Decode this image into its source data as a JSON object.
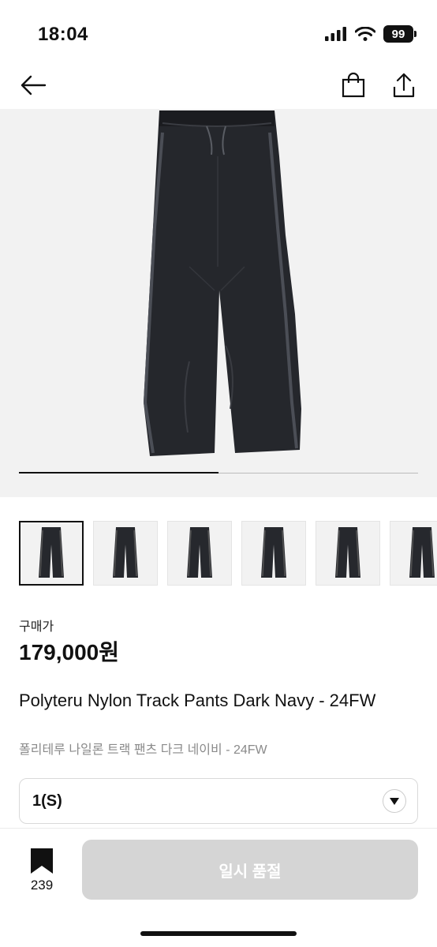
{
  "status_bar": {
    "time": "18:04",
    "battery": "99"
  },
  "nav": {
    "back_icon": "arrow-left-icon",
    "cart_icon": "shopping-bag-icon",
    "share_icon": "share-icon"
  },
  "gallery": {
    "progress": 0.5,
    "thumbnail_count": 6,
    "selected_index": 0
  },
  "product": {
    "price_label": "구매가",
    "price": "179,000원",
    "title": "Polyteru Nylon Track Pants Dark Navy - 24FW",
    "subtitle": "폴리테루 나일론 트랙 팬츠 다크 네이비 - 24FW"
  },
  "option": {
    "selected": "1(S)",
    "arrow_icon": "chevron-down-icon"
  },
  "bottom": {
    "bookmark_icon": "bookmark-icon",
    "bookmark_count": "239",
    "buy_button": "일시 품절"
  },
  "colors": {
    "accent": "#111111",
    "disabled_button": "#d5d5d5",
    "subtitle": "#8a8a8a"
  }
}
